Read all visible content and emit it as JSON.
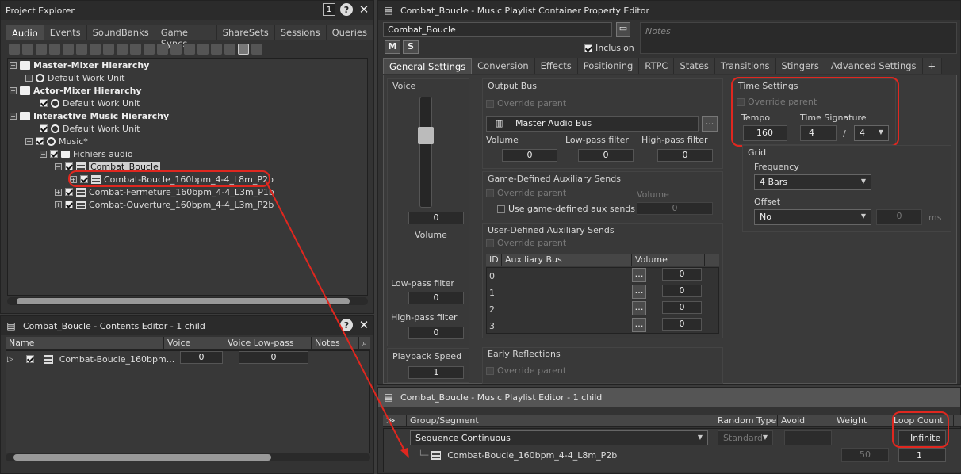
{
  "project_explorer": {
    "title": "Project Explorer",
    "tabs": [
      "Audio",
      "Events",
      "SoundBanks",
      "Game Syncs",
      "ShareSets",
      "Sessions",
      "Queries"
    ],
    "tree": [
      {
        "label": "Master-Mixer Hierarchy",
        "bold": true
      },
      {
        "label": "Default Work Unit"
      },
      {
        "label": "Actor-Mixer Hierarchy",
        "bold": true
      },
      {
        "label": "Default Work Unit"
      },
      {
        "label": "Interactive Music Hierarchy",
        "bold": true
      },
      {
        "label": "Default Work Unit"
      },
      {
        "label": "Music*"
      },
      {
        "label": "Fichiers audio"
      },
      {
        "label": "Combat_Boucle"
      },
      {
        "label": "Combat-Boucle_160bpm_4-4_L8m_P2b"
      },
      {
        "label": "Combat-Fermeture_160bpm_4-4_L3m_P1b"
      },
      {
        "label": "Combat-Ouverture_160bpm_4-4_L3m_P2b"
      }
    ]
  },
  "contents_editor": {
    "title": "Combat_Boucle - Contents Editor - 1 child",
    "columns": [
      "Name",
      "Voice Volume",
      "Voice Low-pass Filter",
      "Notes"
    ],
    "row": {
      "name": "Combat-Boucle_160bpm...",
      "volume": "0",
      "lpf": "0"
    }
  },
  "property_editor": {
    "title": "Combat_Boucle - Music Playlist Container Property Editor",
    "name_value": "Combat_Boucle",
    "notes_placeholder": "Notes",
    "m_label": "M",
    "s_label": "S",
    "inclusion_label": "Inclusion",
    "tabs": [
      "General Settings",
      "Conversion",
      "Effects",
      "Positioning",
      "RTPC",
      "States",
      "Transitions",
      "Stingers",
      "Advanced Settings",
      "+"
    ],
    "voice": {
      "title": "Voice",
      "volume_value": "0",
      "volume_label": "Volume",
      "lpf_label": "Low-pass filter",
      "lpf_value": "0",
      "hpf_label": "High-pass filter",
      "hpf_value": "0",
      "speed_label": "Playback Speed",
      "speed_value": "1"
    },
    "output_bus": {
      "title": "Output Bus",
      "override": "Override parent",
      "bus": "Master Audio Bus",
      "browse": "...",
      "vol_label": "Volume",
      "vol": "0",
      "lpf_label": "Low-pass filter",
      "lpf": "0",
      "hpf_label": "High-pass filter",
      "hpf": "0"
    },
    "game_aux": {
      "title": "Game-Defined Auxiliary Sends",
      "override": "Override parent",
      "use_label": "Use game-defined aux sends",
      "vol_label": "Volume",
      "vol": "0"
    },
    "user_aux": {
      "title": "User-Defined Auxiliary Sends",
      "override": "Override parent",
      "col_id": "ID",
      "col_bus": "Auxiliary Bus",
      "col_vol": "Volume",
      "rows": [
        {
          "id": "0",
          "vol": "0"
        },
        {
          "id": "1",
          "vol": "0"
        },
        {
          "id": "2",
          "vol": "0"
        },
        {
          "id": "3",
          "vol": "0"
        }
      ]
    },
    "early_reflections": {
      "title": "Early Reflections",
      "override": "Override parent"
    },
    "time_settings": {
      "title": "Time Settings",
      "override": "Override parent",
      "tempo_label": "Tempo",
      "tempo": "160",
      "sig_label": "Time Signature",
      "sig_num": "4",
      "sig_sep": "/",
      "sig_den": "4"
    },
    "grid": {
      "title": "Grid",
      "freq_label": "Frequency",
      "freq": "4 Bars",
      "offset_label": "Offset",
      "offset": "No",
      "offset_val": "0",
      "unit": "ms"
    }
  },
  "playlist_editor": {
    "title": "Combat_Boucle - Music Playlist Editor - 1 child",
    "columns": [
      "Group/Segment",
      "Random Type",
      "Avoid Repeat",
      "Weight",
      "Loop Count"
    ],
    "group": {
      "label": "Sequence Continuous",
      "random": "Standard",
      "loop": "Infinite"
    },
    "segment": {
      "label": "Combat-Boucle_160bpm_4-4_L8m_P2b",
      "weight": "50",
      "loop": "1"
    }
  },
  "colors": {
    "highlight": "#e0271f"
  }
}
